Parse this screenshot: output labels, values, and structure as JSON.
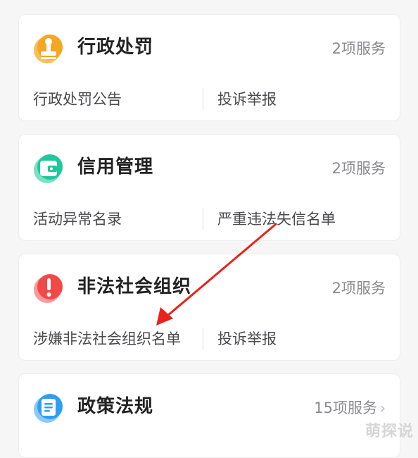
{
  "cards": [
    {
      "title": "行政处罚",
      "count": "2项服务",
      "icon": "stamp-icon",
      "icon_color": "#f5a623",
      "links": [
        "行政处罚公告",
        "投诉举报"
      ]
    },
    {
      "title": "信用管理",
      "count": "2项服务",
      "icon": "wallet-icon",
      "icon_color": "#21c79a",
      "links": [
        "活动异常名录",
        "严重违法失信名单"
      ]
    },
    {
      "title": "非法社会组织",
      "count": "2项服务",
      "icon": "alert-icon",
      "icon_color": "#f24848",
      "links": [
        "涉嫌非法社会组织名单",
        "投诉举报"
      ]
    },
    {
      "title": "政策法规",
      "count": "15项服务",
      "icon": "notebook-icon",
      "icon_color": "#2e9ef5",
      "chevron": "›"
    }
  ],
  "annotation": {
    "type": "arrow",
    "color": "#e8231b"
  },
  "watermark": "萌探说"
}
